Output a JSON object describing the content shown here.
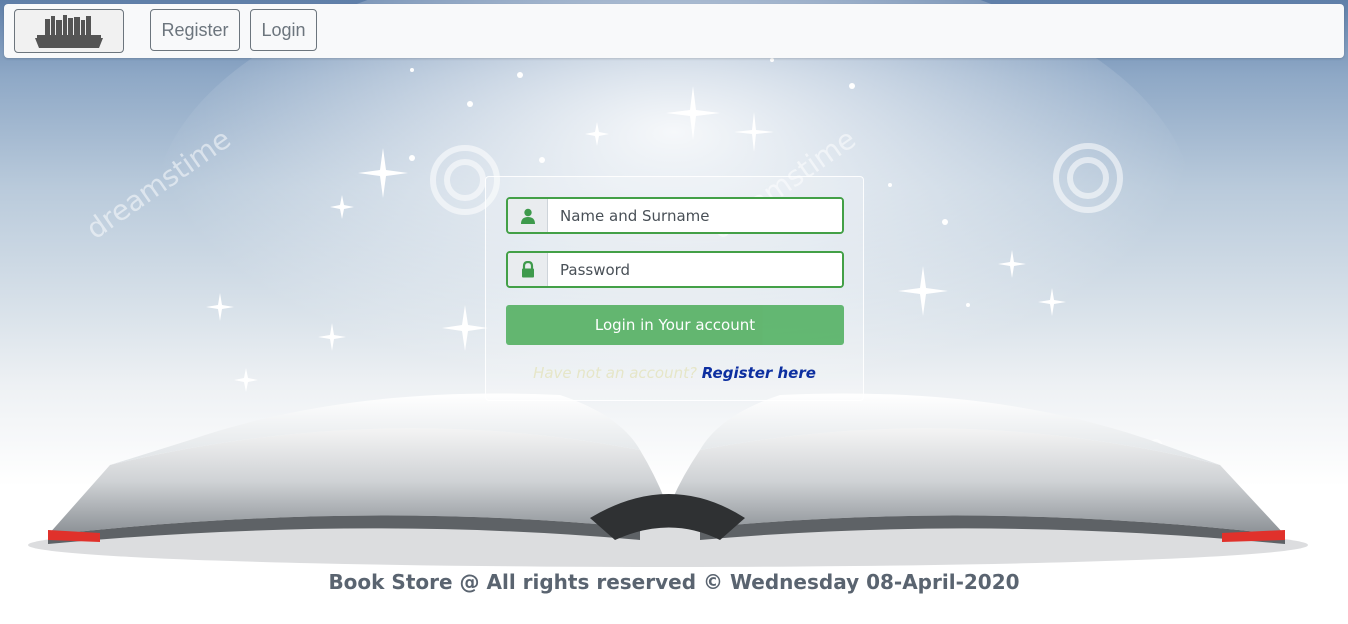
{
  "navbar": {
    "brand_text": "BOOKSTORE",
    "register_label": "Register",
    "login_label": "Login"
  },
  "login_form": {
    "name_placeholder": "Name and Surname",
    "password_placeholder": "Password",
    "submit_label": "Login in Your account",
    "no_account_text": "Have not an account?",
    "register_link_text": "Register here"
  },
  "background": {
    "watermark_text": "dreamstime"
  },
  "footer": {
    "text": "Book Store @ All rights reserved © Wednesday 08-April-2020"
  },
  "colors": {
    "input_border": "#43a047",
    "button": "#5cb46a",
    "register_link": "#0d2fa0",
    "icon": "#3e9a4c"
  },
  "icons": {
    "name_icon": "user-icon",
    "password_icon": "lock-icon"
  }
}
